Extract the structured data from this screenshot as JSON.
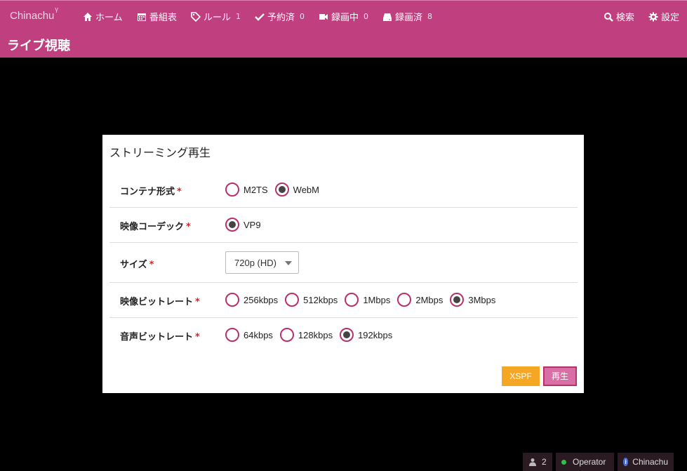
{
  "navbar": {
    "brand": "Chinachu",
    "brand_sup": "γ",
    "items": [
      {
        "label": "ホーム",
        "icon": "home-icon"
      },
      {
        "label": "番組表",
        "icon": "calendar-icon"
      },
      {
        "label": "ルール",
        "icon": "tags-icon",
        "count": "1"
      },
      {
        "label": "予約済",
        "icon": "check-icon",
        "count": "0"
      },
      {
        "label": "録画中",
        "icon": "video-camera-icon",
        "count": "0"
      },
      {
        "label": "録画済",
        "icon": "hdd-icon",
        "count": "8"
      }
    ],
    "search_label": "検索",
    "settings_label": "設定",
    "page_title": "ライブ視聴"
  },
  "dialog": {
    "title": "ストリーミング再生",
    "required_mark": "*",
    "rows": [
      {
        "label": "コンテナ形式",
        "options": [
          {
            "label": "M2TS",
            "selected": false
          },
          {
            "label": "WebM",
            "selected": true
          }
        ]
      },
      {
        "label": "映像コーデック",
        "options": [
          {
            "label": "VP9",
            "selected": true
          }
        ]
      },
      {
        "label": "サイズ",
        "select_value": "720p (HD)"
      },
      {
        "label": "映像ビットレート",
        "options": [
          {
            "label": "256kbps",
            "selected": false
          },
          {
            "label": "512kbps",
            "selected": false
          },
          {
            "label": "1Mbps",
            "selected": false
          },
          {
            "label": "2Mbps",
            "selected": false
          },
          {
            "label": "3Mbps",
            "selected": true
          }
        ]
      },
      {
        "label": "音声ビットレート",
        "options": [
          {
            "label": "64kbps",
            "selected": false
          },
          {
            "label": "128kbps",
            "selected": false
          },
          {
            "label": "192kbps",
            "selected": true
          }
        ]
      }
    ],
    "xspf_label": "XSPF",
    "play_label": "再生"
  },
  "statusbar": {
    "viewers": "2",
    "role": "Operator",
    "app": "Chinachu"
  },
  "colors": {
    "brand": "#c0407f",
    "accent_radio": "#b8306c",
    "xspf_button": "#f5a623",
    "play_button": "#d870a6"
  }
}
